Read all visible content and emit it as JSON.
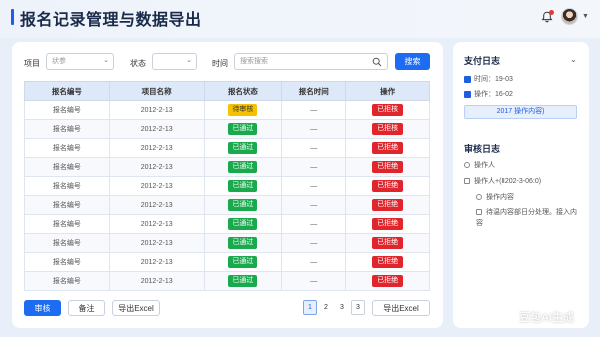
{
  "header": {
    "title": "报名记录管理与数据导出"
  },
  "filters": {
    "project_label": "项目",
    "project_placeholder": "状参",
    "status_label": "状态",
    "status_value": "",
    "time_label": "时间",
    "search_placeholder": "搜索搜索",
    "search_button": "搜索"
  },
  "table": {
    "columns": [
      "报名编号",
      "项目名称",
      "报名状态",
      "报名时间",
      "操作"
    ],
    "rows": [
      {
        "id": "报名编号",
        "project": "2012-2-13",
        "status": "待审核",
        "time": "—",
        "action": "已拒核"
      },
      {
        "id": "报名编号",
        "project": "2012-2-13",
        "status": "已通过",
        "time": "—",
        "action": "已拒核"
      },
      {
        "id": "报名编号",
        "project": "2012-2-13",
        "status": "已通过",
        "time": "—",
        "action": "已拒绝"
      },
      {
        "id": "报名编号",
        "project": "2012-2-13",
        "status": "已通过",
        "time": "—",
        "action": "已拒绝"
      },
      {
        "id": "报名编号",
        "project": "2012-2-13",
        "status": "已通过",
        "time": "—",
        "action": "已拒绝"
      },
      {
        "id": "报名编号",
        "project": "2012-2-13",
        "status": "已通过",
        "time": "—",
        "action": "已拒绝"
      },
      {
        "id": "报名编号",
        "project": "2012-2-13",
        "status": "已通过",
        "time": "—",
        "action": "已拒绝"
      },
      {
        "id": "报名编号",
        "project": "2012-2-13",
        "status": "已通过",
        "time": "—",
        "action": "已拒绝"
      },
      {
        "id": "报名编号",
        "project": "2012-2-13",
        "status": "已通过",
        "time": "—",
        "action": "已拒绝"
      },
      {
        "id": "报名编号",
        "project": "2012-2-13",
        "status": "已通过",
        "time": "—",
        "action": "已拒绝"
      }
    ]
  },
  "actions": {
    "review": "审核",
    "note": "备注",
    "export": "导出Excel",
    "export_right": "导出Excel"
  },
  "pagination": {
    "pages": [
      "1",
      "2",
      "3"
    ],
    "current": "1"
  },
  "side": {
    "pay_log_title": "支付日志",
    "time_row": "时间：19-03",
    "op_row": "操作：16-02",
    "highlight": "2017 操作内容)",
    "audit_title": "审核日志",
    "item1": "操作人",
    "item2": "操作人+(Ⅱ202-3-06:0)",
    "item3": "操作内容",
    "item4": "待温内容部日分处理。接入内容"
  },
  "watermark": "豆包AI生成",
  "colors": {
    "primary": "#1d6cf2",
    "pending": "#f6c100",
    "pass": "#1aa94c",
    "reject": "#e0262c"
  }
}
